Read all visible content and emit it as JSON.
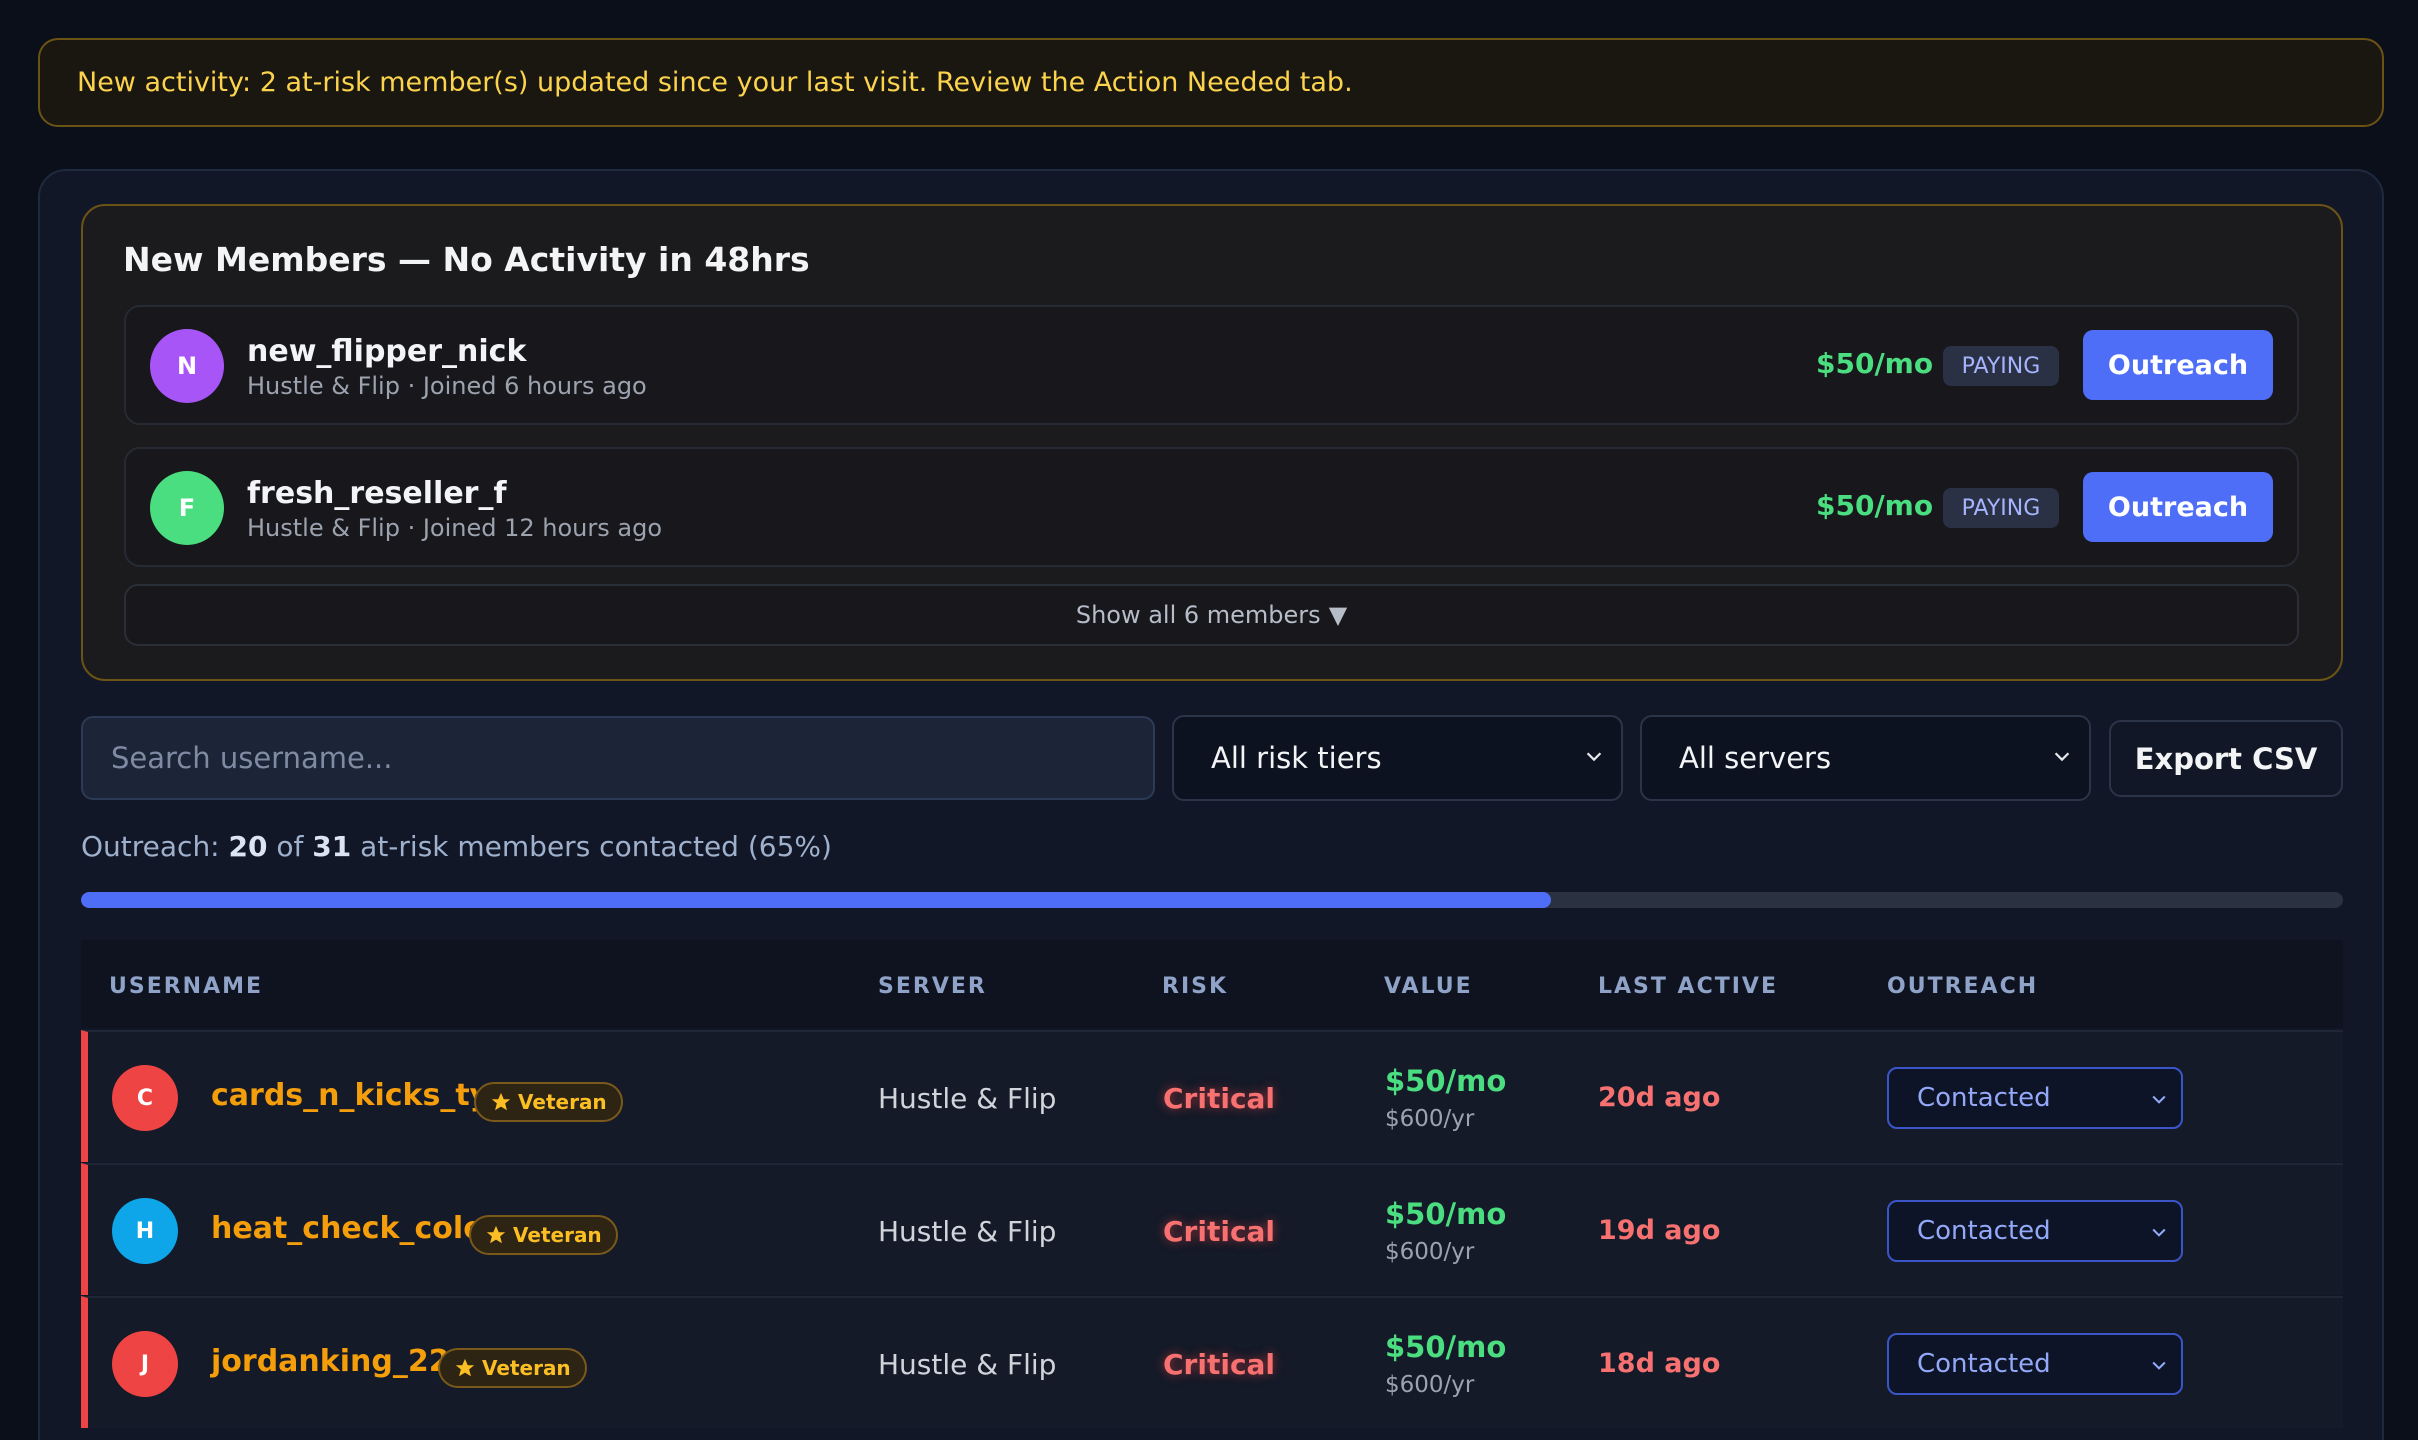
{
  "banner": {
    "text": "New activity: 2 at-risk member(s) updated since your last visit. Review the Action Needed tab."
  },
  "new_members": {
    "title": "New Members — No Activity in 48hrs",
    "members": [
      {
        "initial": "N",
        "avatar_color": "#a855f7",
        "name": "new_flipper_nick",
        "subtitle": "Hustle & Flip · Joined 6 hours ago",
        "price": "$50/mo",
        "status": "PAYING",
        "action": "Outreach"
      },
      {
        "initial": "F",
        "avatar_color": "#4ade80",
        "name": "fresh_reseller_f",
        "subtitle": "Hustle & Flip · Joined 12 hours ago",
        "price": "$50/mo",
        "status": "PAYING",
        "action": "Outreach"
      }
    ],
    "show_all": "Show all 6 members",
    "show_all_icon": "▼"
  },
  "filters": {
    "search_placeholder": "Search username...",
    "risk_select": "All risk tiers",
    "server_select": "All servers",
    "export": "Export CSV"
  },
  "progress": {
    "prefix": "Outreach: ",
    "contacted": "20",
    "of": " of ",
    "total": "31",
    "suffix": " at-risk members contacted (65%)",
    "fraction": 0.65
  },
  "table": {
    "headers": {
      "username": "USERNAME",
      "server": "SERVER",
      "risk": "RISK",
      "value": "VALUE",
      "last_active": "LAST ACTIVE",
      "outreach": "OUTREACH"
    },
    "rows": [
      {
        "initial": "C",
        "avatar_color": "#ef4444",
        "username": "cards_n_kicks_ty",
        "badge": "Veteran",
        "server": "Hustle & Flip",
        "risk": "Critical",
        "value": "$50/mo",
        "value_year": "$600/yr",
        "last_active": "20d ago",
        "outreach": "Contacted"
      },
      {
        "initial": "H",
        "avatar_color": "#0ea5e9",
        "username": "heat_check_cole",
        "badge": "Veteran",
        "server": "Hustle & Flip",
        "risk": "Critical",
        "value": "$50/mo",
        "value_year": "$600/yr",
        "last_active": "19d ago",
        "outreach": "Contacted"
      },
      {
        "initial": "J",
        "avatar_color": "#ef4444",
        "username": "jordanking_22",
        "badge": "Veteran",
        "server": "Hustle & Flip",
        "risk": "Critical",
        "value": "$50/mo",
        "value_year": "$600/yr",
        "last_active": "18d ago",
        "outreach": "Contacted"
      }
    ]
  }
}
